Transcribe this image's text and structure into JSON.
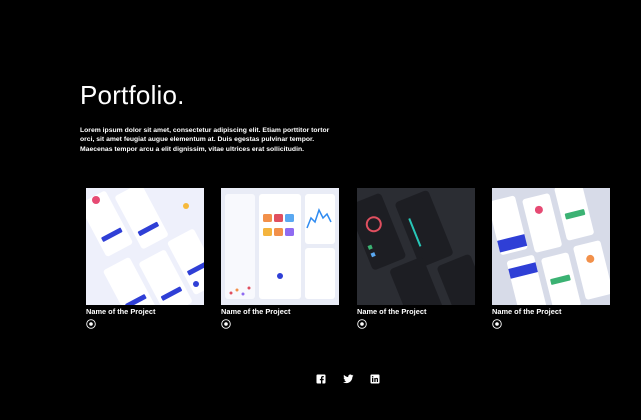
{
  "portfolio": {
    "title": "Portfolio.",
    "description": "Lorem ipsum dolor sit amet, consectetur adipiscing elit. Etiam porttitor tortor orci, sit amet feugiat augue elementum at. Duis egestas pulvinar tempor. Maecenas tempor arcu a elit dignissim, vitae ultrices erat sollicitudin.",
    "projects": [
      {
        "name": "Name of the Project",
        "image": "blue-mobile-app-screens",
        "icon": "plus-circle-icon"
      },
      {
        "name": "Name of the Project",
        "image": "light-dashboard-app-screens",
        "icon": "plus-circle-icon"
      },
      {
        "name": "Name of the Project",
        "image": "dark-app-screens",
        "icon": "plus-circle-icon"
      },
      {
        "name": "Name of the Project",
        "image": "colorful-finance-app-screens",
        "icon": "plus-circle-icon"
      }
    ]
  },
  "social": [
    "facebook-icon",
    "twitter-icon",
    "linkedin-icon"
  ],
  "colors": {
    "background": "#000000",
    "text": "#ffffff",
    "accent_blue": "#2f3fd6"
  }
}
